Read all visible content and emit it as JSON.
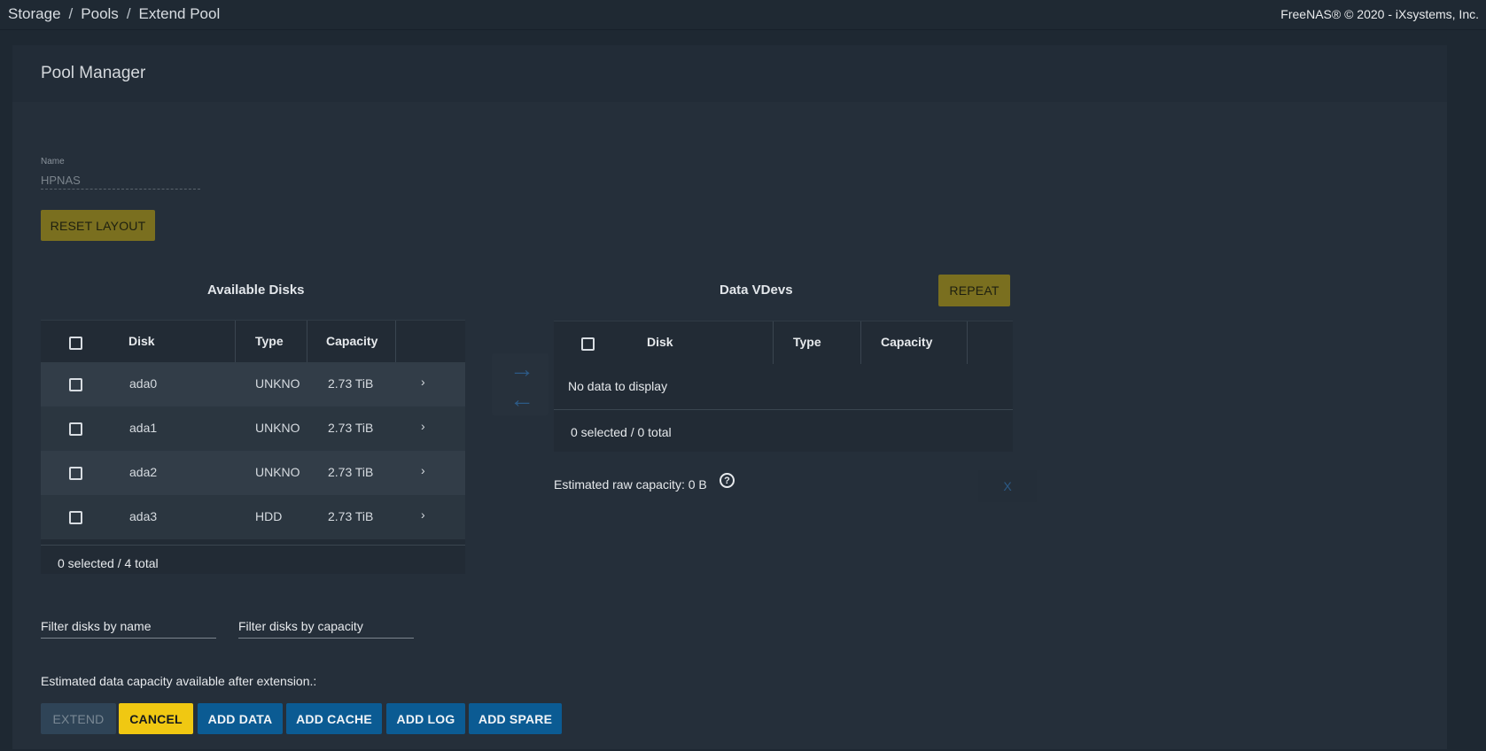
{
  "breadcrumb": [
    "Storage",
    "Pools",
    "Extend Pool"
  ],
  "copyright": "FreeNAS® © 2020 - iXsystems, Inc.",
  "card": {
    "title": "Pool Manager",
    "name_label": "Name",
    "name_value": "HPNAS",
    "reset_label": "RESET LAYOUT"
  },
  "available_disks": {
    "title": "Available Disks",
    "columns": [
      "Disk",
      "Type",
      "Capacity"
    ],
    "rows": [
      {
        "disk": "ada0",
        "type": "UNKNO",
        "capacity": "2.73 TiB"
      },
      {
        "disk": "ada1",
        "type": "UNKNO",
        "capacity": "2.73 TiB"
      },
      {
        "disk": "ada2",
        "type": "UNKNO",
        "capacity": "2.73 TiB"
      },
      {
        "disk": "ada3",
        "type": "HDD",
        "capacity": "2.73 TiB"
      }
    ],
    "footer": "0 selected / 4 total"
  },
  "data_vdevs": {
    "title": "Data VDevs",
    "repeat_label": "REPEAT",
    "columns": [
      "Disk",
      "Type",
      "Capacity"
    ],
    "empty_text": "No data to display",
    "footer": "0 selected / 0 total",
    "estimated_raw": "Estimated raw capacity: 0 B",
    "remove_label": "X"
  },
  "filters": {
    "name_placeholder": "Filter disks by name",
    "capacity_placeholder": "Filter disks by capacity"
  },
  "estimated_data": "Estimated data capacity available after extension.:",
  "actions": {
    "extend": "EXTEND",
    "cancel": "CANCEL",
    "add_data": "ADD DATA",
    "add_cache": "ADD CACHE",
    "add_log": "ADD LOG",
    "add_spare": "ADD SPARE"
  },
  "icons": {
    "move_right": "arrow-right-icon",
    "move_left": "arrow-left-icon",
    "help": "help-circle-icon",
    "expand": "chevron-right-icon"
  },
  "colors": {
    "olive": "#7a6f1f",
    "yellow": "#f0c812",
    "blue": "#0b5b93"
  }
}
